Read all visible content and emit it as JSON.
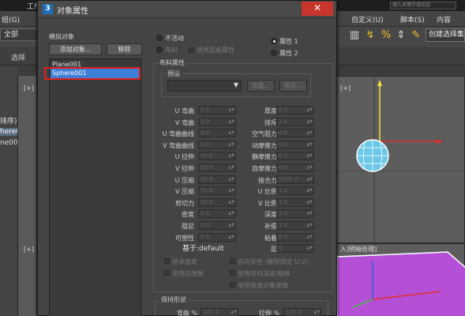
{
  "background": {
    "app_title": "工作",
    "search_placeholder": "键入关键字或短语",
    "menus": [
      "组(G)",
      "自定义(U)",
      "脚本(S)",
      "内容"
    ],
    "left_dropdown": "全部",
    "select_label": "选择",
    "named_selection": "创建选择集",
    "left_panel_items": [
      "排序)",
      "here0",
      "ne00"
    ],
    "viewport_labels": [
      "[+]",
      "[+]",
      "[+]"
    ],
    "viewport_bottom_label": "入]明暗处理]"
  },
  "dialog": {
    "title": "对象属性",
    "close_symbol": "✕",
    "simulated_objects_label": "模拟对象",
    "add_object_button": "添加对象...",
    "remove_button": "移除",
    "objects": [
      "Plane001",
      "Sphere001"
    ],
    "selected_object_index": 1,
    "mode": {
      "inactive": "不活动",
      "cloth": "布料",
      "use_panel_properties": "使用面板属性",
      "property1": "属性 1",
      "property2": "属性 2",
      "selected": "property1"
    },
    "cloth_properties_title": "布料属性",
    "preset_label": "预设",
    "load_button": "加载...",
    "save_button": "保存...",
    "left_params": [
      {
        "label": "U 弯曲",
        "value": "5.0"
      },
      {
        "label": "V 弯曲",
        "value": "5.0"
      },
      {
        "label": "U 弯曲曲线",
        "value": "0.0"
      },
      {
        "label": "V 弯曲曲线",
        "value": "0.0"
      },
      {
        "label": "U 拉伸",
        "value": "50.0"
      },
      {
        "label": "V 拉伸",
        "value": "50.0"
      },
      {
        "label": "U 压缩",
        "value": "50.0"
      },
      {
        "label": "V 压缩",
        "value": "50.0"
      },
      {
        "label": "剪切力",
        "value": "50.0"
      },
      {
        "label": "密度",
        "value": "0.0"
      },
      {
        "label": "阻尼",
        "value": "0.0"
      },
      {
        "label": "可塑性",
        "value": "0.0"
      }
    ],
    "right_params": [
      {
        "label": "厚度",
        "value": "0.0"
      },
      {
        "label": "排斥",
        "value": "1.0"
      },
      {
        "label": "空气阻力",
        "value": "0.0"
      },
      {
        "label": "动摩擦力",
        "value": "0.1"
      },
      {
        "label": "静摩擦力",
        "value": "0.5"
      },
      {
        "label": "自摩擦力",
        "value": "0.0"
      },
      {
        "label": "接合力",
        "value": "5000.0"
      },
      {
        "label": "U 比例",
        "value": "1.0"
      },
      {
        "label": "V 比例",
        "value": "1.0"
      },
      {
        "label": "深度",
        "value": "1.0"
      },
      {
        "label": "补偿",
        "value": "1.0"
      },
      {
        "label": "粘着",
        "value": "0.0"
      },
      {
        "label": "层",
        "value": "0"
      }
    ],
    "based_on": "基于:default",
    "checkboxes": [
      "继承速度",
      "使用边弹簧",
      "各向异性 (解除锁定 U,V)",
      "使用布料深度/偏移",
      "使用碰撞对象摩擦"
    ],
    "keep_shape_title": "保持形状",
    "keep_shape": [
      {
        "label": "弯曲 %",
        "value": "100.0"
      },
      {
        "label": "拉伸 %",
        "value": "100.0"
      }
    ]
  }
}
